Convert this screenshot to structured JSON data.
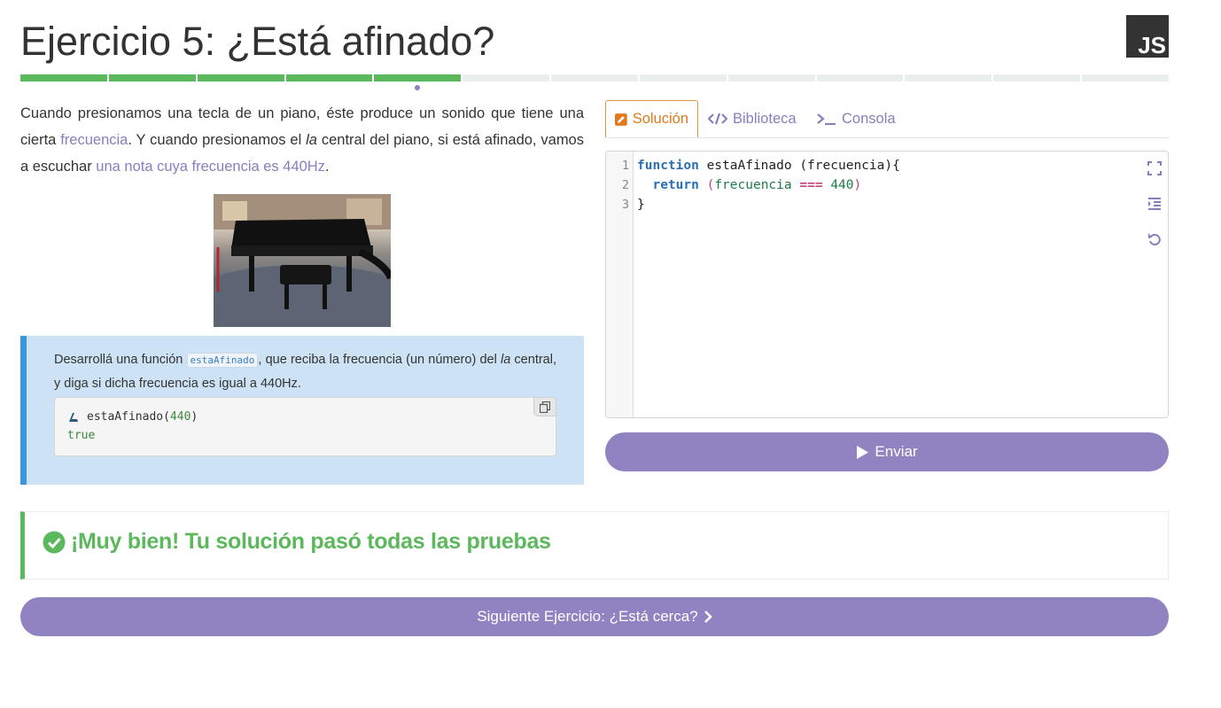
{
  "header": {
    "title": "Ejercicio 5: ¿Está afinado?",
    "logo_text": "JS"
  },
  "progress": {
    "total_segments": 13,
    "completed_segments": 5,
    "current_index": 5
  },
  "description": {
    "p1": "Cuando presionamos una tecla de un piano, éste produce un sonido que tiene una cierta ",
    "link1": "frecuencia",
    "p2": ". Y cuando presionamos el ",
    "em1": "la",
    "p3": " central del piano, si está afinado, vamos a escuchar ",
    "link2": "una nota cuya frecuencia es 440Hz",
    "p4": "."
  },
  "task": {
    "t1": "Desarrollá una función ",
    "code": "estaAfinado",
    "t2": ", que reciba la frecuencia (un número) del ",
    "em": "la",
    "t3": " central, y diga si dicha frecuencia es igual a 440Hz.",
    "example_call": "estaAfinado(",
    "example_arg": "440",
    "example_close": ")",
    "example_result": "true"
  },
  "tabs": [
    {
      "label": "Solución",
      "icon": "pencil-icon",
      "active": true
    },
    {
      "label": "Biblioteca",
      "icon": "code-icon",
      "active": false
    },
    {
      "label": "Consola",
      "icon": "terminal-icon",
      "active": false
    }
  ],
  "editor": {
    "line_numbers": [
      "1",
      "2",
      "3"
    ],
    "l1_kw": "function",
    "l1_rest": " estaAfinado (frecuencia){",
    "l2_indent": "  ",
    "l2_kw": "return",
    "l2_sp": " ",
    "l2_open": "(",
    "l2_arg": "frecuencia",
    "l2_sp2": " ",
    "l2_op": "===",
    "l2_sp3": " ",
    "l2_num": "440",
    "l2_close": ")",
    "l3": "}"
  },
  "buttons": {
    "send_label": "Enviar",
    "next_label": "Siguiente Ejercicio: ¿Está cerca?"
  },
  "result": {
    "message": "¡Muy bien! Tu solución pasó todas las pruebas"
  },
  "colors": {
    "accent_purple": "#9183c1",
    "success_green": "#5cb85c",
    "active_tab_orange": "#e07a1c",
    "task_border_blue": "#3a96dd"
  }
}
